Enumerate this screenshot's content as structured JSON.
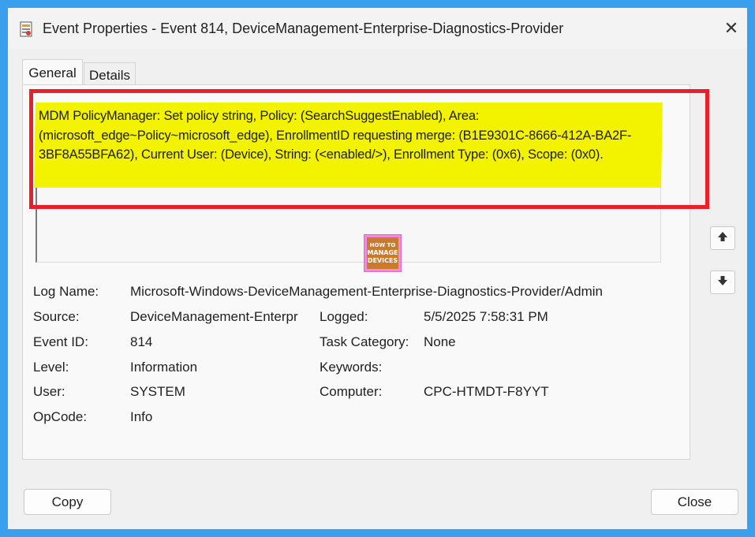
{
  "window": {
    "title": "Event Properties - Event 814, DeviceManagement-Enterprise-Diagnostics-Provider",
    "app_icon": "event-viewer-icon",
    "close_glyph": "✕"
  },
  "tabs": [
    {
      "label": "General",
      "selected": true
    },
    {
      "label": "Details",
      "selected": false
    }
  ],
  "description": "MDM PolicyManager: Set policy string, Policy: (SearchSuggestEnabled), Area: (microsoft_edge~Policy~microsoft_edge), EnrollmentID requesting merge: (B1E9301C-8666-412A-BA2F-3BF8A55BFA62), Current User: (Device), String: (<enabled/>), Enrollment Type: (0x6), Scope: (0x0).",
  "watermark": {
    "line1": "HOW TO",
    "line2": "MANAGE",
    "line3": "DEVICES"
  },
  "fields": {
    "log_name": {
      "label": "Log Name:",
      "value": "Microsoft-Windows-DeviceManagement-Enterprise-Diagnostics-Provider/Admin"
    },
    "source": {
      "label": "Source:",
      "value": "DeviceManagement-Enterpr"
    },
    "logged": {
      "label": "Logged:",
      "value": "5/5/2025 7:58:31 PM"
    },
    "event_id": {
      "label": "Event ID:",
      "value": "814"
    },
    "task_category": {
      "label": "Task Category:",
      "value": "None"
    },
    "level": {
      "label": "Level:",
      "value": "Information"
    },
    "keywords": {
      "label": "Keywords:",
      "value": ""
    },
    "user": {
      "label": "User:",
      "value": "SYSTEM"
    },
    "computer": {
      "label": "Computer:",
      "value": "CPC-HTMDT-F8YYT"
    },
    "opcode": {
      "label": "OpCode:",
      "value": "Info"
    }
  },
  "buttons": {
    "copy": "Copy",
    "close": "Close"
  },
  "colors": {
    "highlight": "#f3f300",
    "annotation_frame": "#e8202a",
    "background": "#3aa0ee"
  }
}
